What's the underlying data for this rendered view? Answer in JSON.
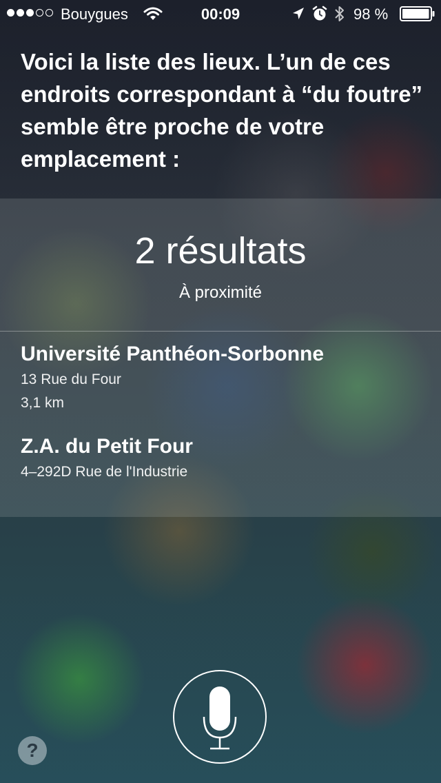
{
  "status_bar": {
    "signal": {
      "bars_filled": 3,
      "bars_total": 5
    },
    "carrier": "Bouygues",
    "time": "00:09",
    "battery_percent": "98 %",
    "icons": [
      "wifi-icon",
      "location-arrow-icon",
      "alarm-icon",
      "bluetooth-icon",
      "battery-icon"
    ]
  },
  "siri": {
    "response": "Voici la liste des lieux. L’un de ces endroits correspondant à “du foutre” semble être proche de votre emplacement :"
  },
  "results": {
    "count_label": "2 résultats",
    "subtitle": "À proximité",
    "items": [
      {
        "name": "Université Panthéon-Sorbonne",
        "address": "13 Rue du Four",
        "distance": "3,1 km"
      },
      {
        "name": "Z.A. du Petit Four",
        "address": "4–292D Rue de l'Industrie"
      }
    ]
  },
  "controls": {
    "mic_icon": "microphone-icon",
    "help_label": "?"
  },
  "colors": {
    "text": "#ffffff",
    "panel": "rgba(175,185,185,0.20)"
  }
}
